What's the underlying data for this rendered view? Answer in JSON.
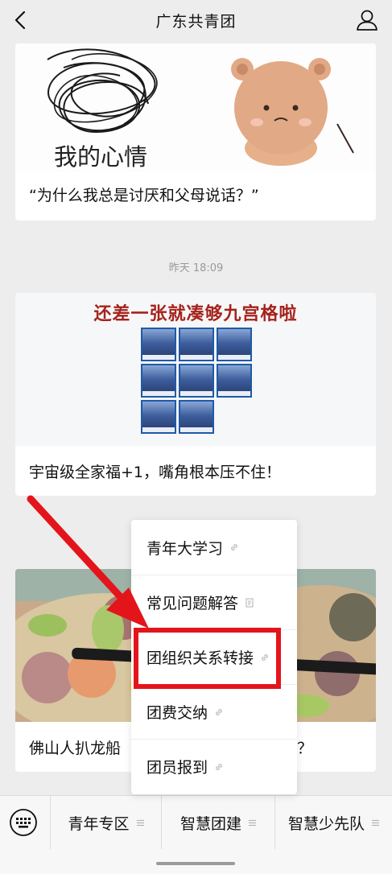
{
  "header": {
    "title": "广东共青团",
    "back_icon": "chevron-left-icon",
    "profile_icon": "user-icon"
  },
  "articles": [
    {
      "image_text": "我的心情",
      "caption": "“为什么我总是讨厌和父母说话？”"
    },
    {
      "image_title": "还差一张就凑够九宫格啦",
      "caption": "宇宙级全家福+1，嘴角根本压不住！"
    },
    {
      "caption_left": "佛山人扒龙船",
      "caption_right": "？"
    }
  ],
  "timestamp": "昨天 18:09",
  "menu": {
    "items": [
      {
        "label": "青年大学习",
        "icon": "link-icon"
      },
      {
        "label": "常见问题解答",
        "icon": "document-icon"
      },
      {
        "label": "团组织关系转接",
        "icon": "link-icon"
      },
      {
        "label": "团费交纳",
        "icon": "link-icon"
      },
      {
        "label": "团员报到",
        "icon": "link-icon"
      }
    ]
  },
  "annotations": {
    "highlight_color": "#e3151b",
    "arrow_color": "#e3151b"
  },
  "bottom_bar": {
    "keyboard_icon": "keyboard-icon",
    "tabs": [
      {
        "label": "青年专区",
        "icon": "menu-lines-icon"
      },
      {
        "label": "智慧团建",
        "icon": "menu-lines-icon"
      },
      {
        "label": "智慧少先队",
        "icon": "menu-lines-icon"
      }
    ]
  }
}
